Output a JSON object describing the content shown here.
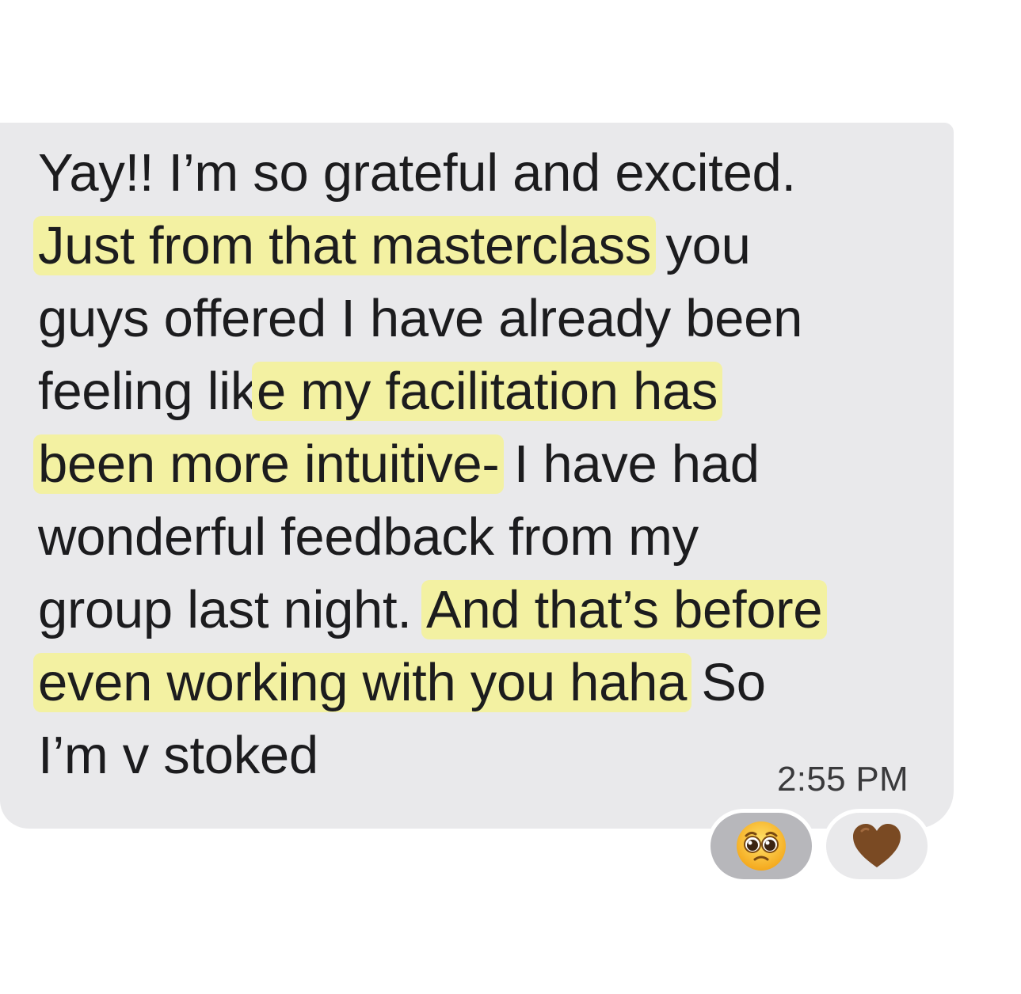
{
  "message": {
    "lines": [
      {
        "plain_before": "Yay!! I’m so grateful and excited.",
        "highlight": "",
        "plain_after": ""
      },
      {
        "plain_before": "",
        "highlight": "Just from that masterclass",
        "plain_after": " you"
      },
      {
        "plain_before": "guys offered I have already been",
        "highlight": "",
        "plain_after": ""
      },
      {
        "plain_before": "feeling lik",
        "highlight": "e my facilitation has",
        "plain_after": ""
      },
      {
        "plain_before": "",
        "highlight": "been more intuitive-",
        "plain_after": " I have had"
      },
      {
        "plain_before": "wonderful feedback from my",
        "highlight": "",
        "plain_after": ""
      },
      {
        "plain_before": "group last night. ",
        "highlight": "And that’s before",
        "plain_after": ""
      },
      {
        "plain_before": "",
        "highlight": "even working with you haha",
        "plain_after": " So"
      },
      {
        "plain_before": "I’m v stoked",
        "highlight": "",
        "plain_after": ""
      }
    ],
    "timestamp": "2:55 PM"
  },
  "reactions": [
    {
      "icon": "pleading-face-emoji-icon",
      "emoji": "🥺",
      "selected": true
    },
    {
      "icon": "brown-heart-emoji-icon",
      "emoji": "🤎",
      "selected": false
    }
  ],
  "colors": {
    "bubble": "#e9e9eb",
    "highlight": "#f3f1a2",
    "text": "#1c1c1e",
    "reaction_selected": "#b7b7bb",
    "heart": "#7a4a23"
  }
}
